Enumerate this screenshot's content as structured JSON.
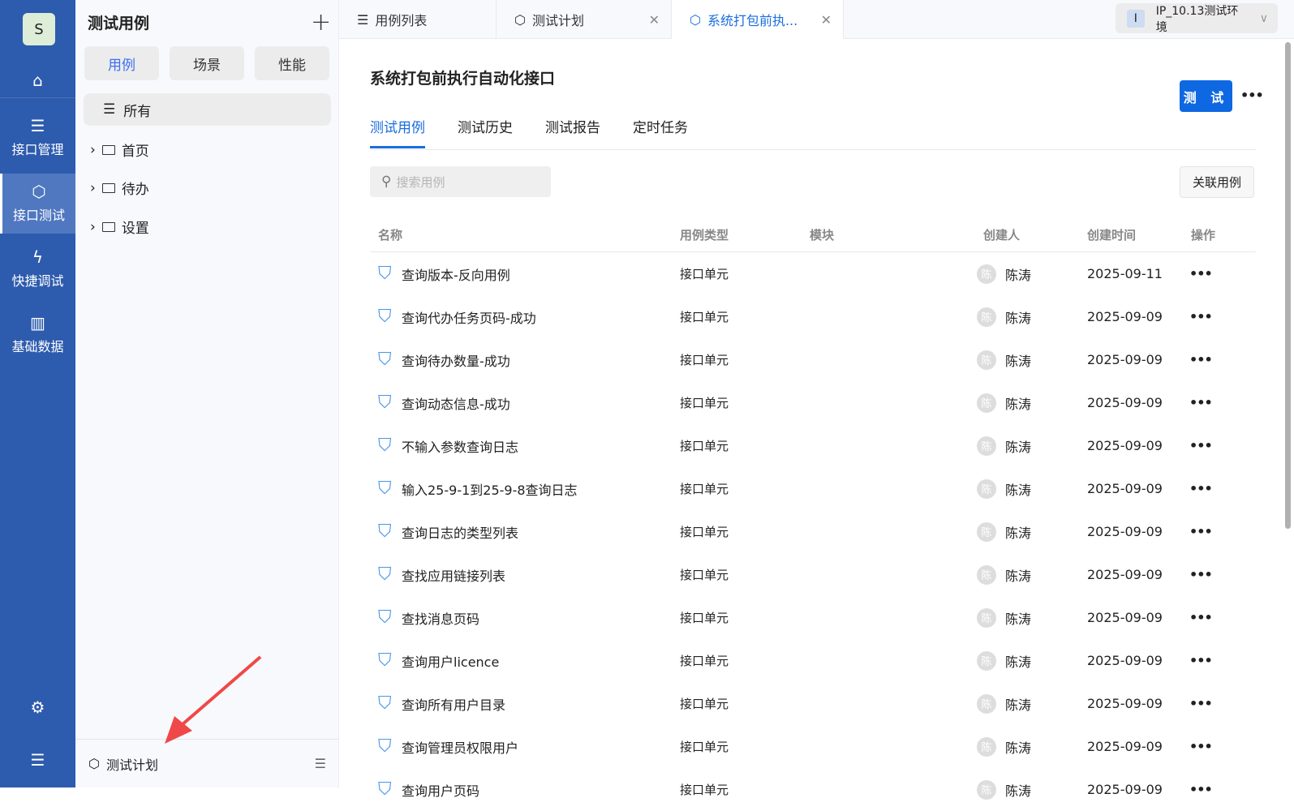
{
  "nav": {
    "logo": "S",
    "items": [
      {
        "label": "",
        "icon": "home-icon"
      },
      {
        "label": "接口管理",
        "icon": "sliders-icon"
      },
      {
        "label": "接口测试",
        "icon": "cube-icon"
      },
      {
        "label": "快捷调试",
        "icon": "lightning-icon"
      },
      {
        "label": "基础数据",
        "icon": "chart-icon"
      }
    ]
  },
  "panel": {
    "title": "测试用例",
    "segments": [
      "用例",
      "场景",
      "性能"
    ],
    "all": "所有",
    "folders": [
      "首页",
      "待办",
      "设置"
    ],
    "footer": "测试计划"
  },
  "tabs": [
    {
      "label": "用例列表"
    },
    {
      "label": "测试计划"
    },
    {
      "label": "系统打包前执..."
    }
  ],
  "env": {
    "badge": "I",
    "label": "IP_10.13测试环境"
  },
  "main": {
    "title": "系统打包前执行自动化接口",
    "test_button": "测 试",
    "more": "•••",
    "subtabs": [
      "测试用例",
      "测试历史",
      "测试报告",
      "定时任务"
    ],
    "search_placeholder": "搜索用例",
    "link_button": "关联用例",
    "columns": [
      "名称",
      "用例类型",
      "模块",
      "创建人",
      "创建时间",
      "操作"
    ],
    "rows": [
      {
        "name": "查询版本-反向用例",
        "type": "接口单元",
        "avatar": "陈",
        "creator": "陈涛",
        "date": "2025-09-11"
      },
      {
        "name": "查询代办任务页码-成功",
        "type": "接口单元",
        "avatar": "陈",
        "creator": "陈涛",
        "date": "2025-09-09"
      },
      {
        "name": "查询待办数量-成功",
        "type": "接口单元",
        "avatar": "陈",
        "creator": "陈涛",
        "date": "2025-09-09"
      },
      {
        "name": "查询动态信息-成功",
        "type": "接口单元",
        "avatar": "陈",
        "creator": "陈涛",
        "date": "2025-09-09"
      },
      {
        "name": "不输入参数查询日志",
        "type": "接口单元",
        "avatar": "陈",
        "creator": "陈涛",
        "date": "2025-09-09"
      },
      {
        "name": "输入25-9-1到25-9-8查询日志",
        "type": "接口单元",
        "avatar": "陈",
        "creator": "陈涛",
        "date": "2025-09-09"
      },
      {
        "name": "查询日志的类型列表",
        "type": "接口单元",
        "avatar": "陈",
        "creator": "陈涛",
        "date": "2025-09-09"
      },
      {
        "name": "查找应用链接列表",
        "type": "接口单元",
        "avatar": "陈",
        "creator": "陈涛",
        "date": "2025-09-09"
      },
      {
        "name": "查找消息页码",
        "type": "接口单元",
        "avatar": "陈",
        "creator": "陈涛",
        "date": "2025-09-09"
      },
      {
        "name": "查询用户licence",
        "type": "接口单元",
        "avatar": "陈",
        "creator": "陈涛",
        "date": "2025-09-09"
      },
      {
        "name": "查询所有用户目录",
        "type": "接口单元",
        "avatar": "陈",
        "creator": "陈涛",
        "date": "2025-09-09"
      },
      {
        "name": "查询管理员权限用户",
        "type": "接口单元",
        "avatar": "陈",
        "creator": "陈涛",
        "date": "2025-09-09"
      },
      {
        "name": "查询用户页码",
        "type": "接口单元",
        "avatar": "陈",
        "creator": "陈涛",
        "date": "2025-09-09"
      }
    ]
  }
}
